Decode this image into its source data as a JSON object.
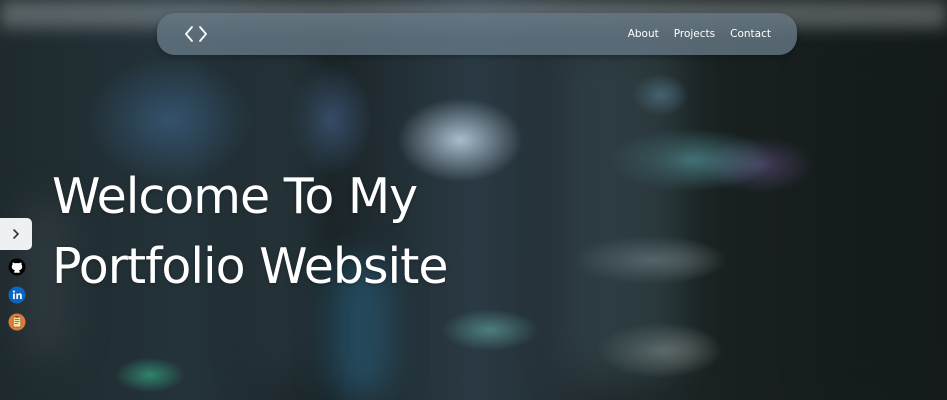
{
  "navbar": {
    "logo_icon": "code-brackets-icon",
    "links": [
      {
        "label": "About"
      },
      {
        "label": "Projects"
      },
      {
        "label": "Contact"
      }
    ]
  },
  "hero": {
    "line1": "Welcome To My",
    "line2": "Portfolio Website"
  },
  "sidebar": {
    "toggle_icon": "chevron-right-icon",
    "social": [
      {
        "icon": "github-icon",
        "color": "#000000"
      },
      {
        "icon": "linkedin-icon",
        "color": "#0a66c2"
      },
      {
        "icon": "resume-icon",
        "color": "#e07a3a"
      }
    ]
  },
  "colors": {
    "navbar_bg": "#64768a",
    "text": "#ffffff",
    "toggle_bg": "#eef0f2"
  }
}
